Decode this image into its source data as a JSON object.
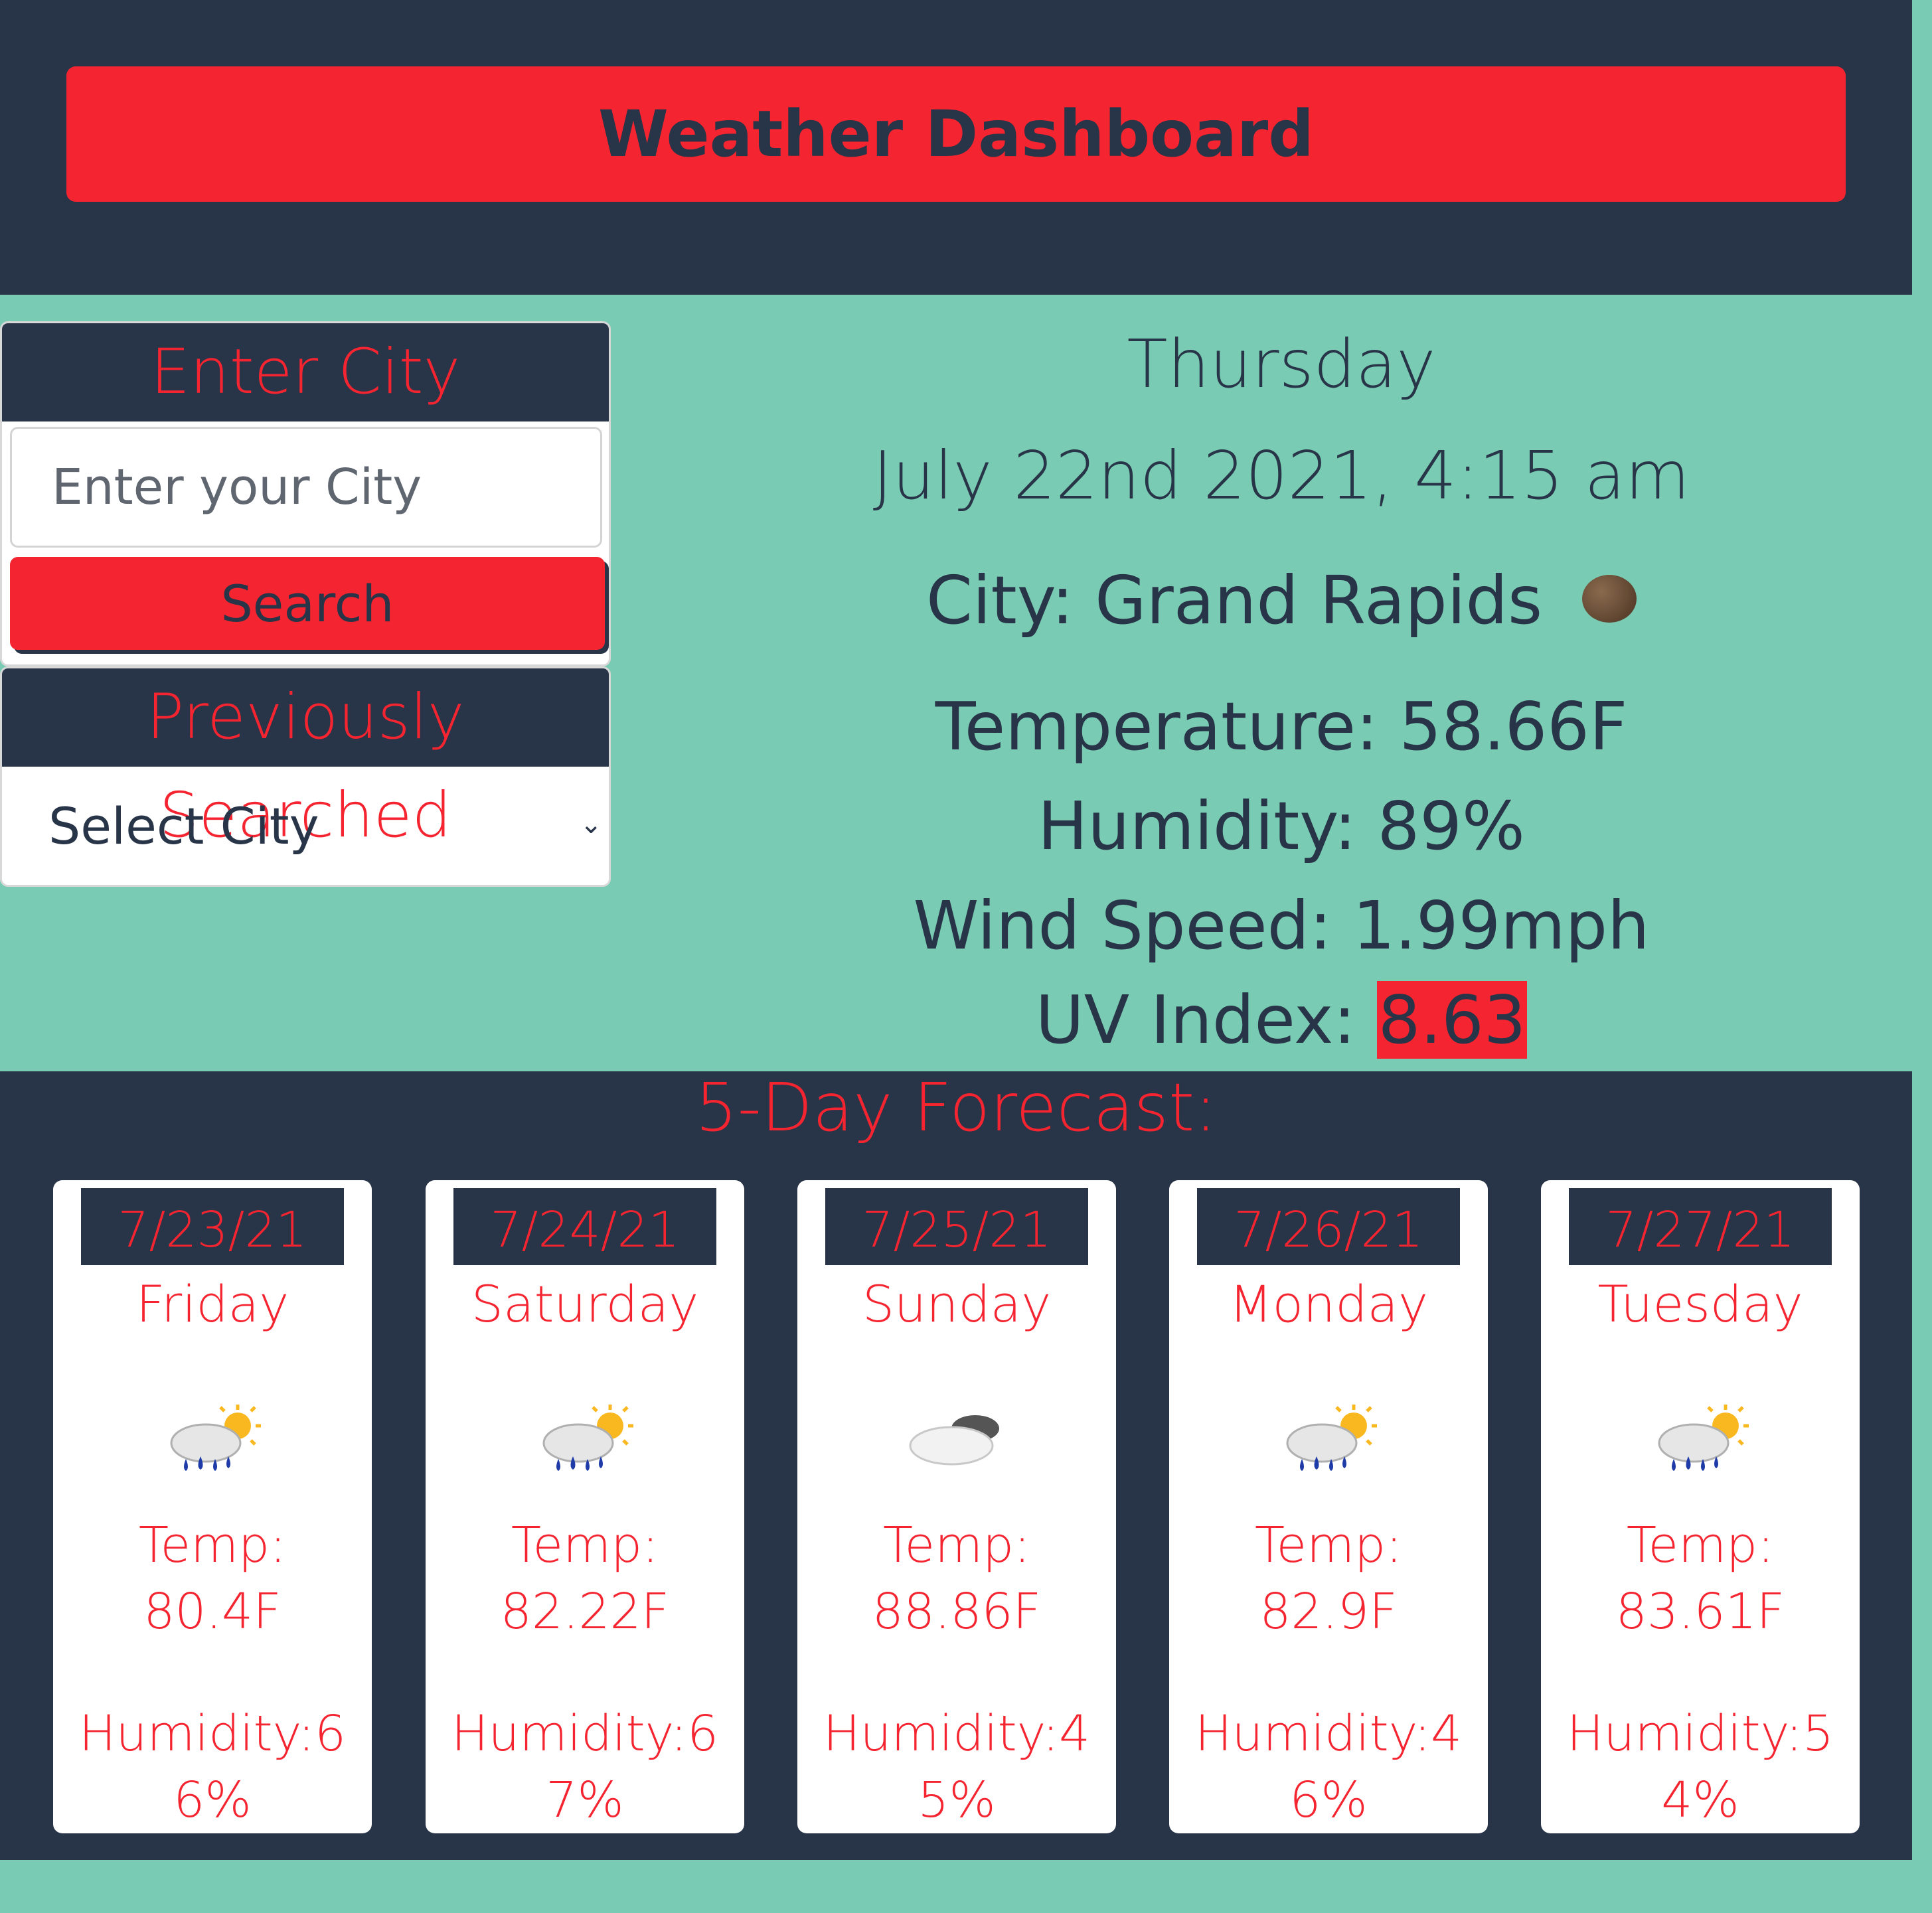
{
  "header": {
    "title": "Weather Dashboard"
  },
  "search_panel": {
    "heading": "Enter City",
    "input_placeholder": "Enter your City",
    "search_label": "Search"
  },
  "history_panel": {
    "heading": "Previously Searched",
    "select_value": "Select City"
  },
  "current": {
    "day": "Thursday",
    "datetime": "July 22nd 2021, 4:15 am",
    "city": "City: Grand Rapids",
    "weather_icon": "moon-icon",
    "temperature": "Temperature: 58.66F",
    "humidity": "Humidity: 89%",
    "wind": "Wind Speed: 1.99mph",
    "uv_label": "UV Index: ",
    "uv_value": "8.63"
  },
  "forecast": {
    "title": "5-Day Forecast:",
    "days": [
      {
        "date": "7/23/21",
        "day": "Friday",
        "icon": "rain-sun-icon",
        "temp_label": "Temp:",
        "temp": "80.4F",
        "humidity": "Humidity:66%"
      },
      {
        "date": "7/24/21",
        "day": "Saturday",
        "icon": "rain-sun-icon",
        "temp_label": "Temp:",
        "temp": "82.22F",
        "humidity": "Humidity:67%"
      },
      {
        "date": "7/25/21",
        "day": "Sunday",
        "icon": "cloud-icon",
        "temp_label": "Temp:",
        "temp": "88.86F",
        "humidity": "Humidity:45%"
      },
      {
        "date": "7/26/21",
        "day": "Monday",
        "icon": "rain-sun-icon",
        "temp_label": "Temp:",
        "temp": "82.9F",
        "humidity": "Humidity:46%"
      },
      {
        "date": "7/27/21",
        "day": "Tuesday",
        "icon": "rain-sun-icon",
        "temp_label": "Temp:",
        "temp": "83.61F",
        "humidity": "Humidity:54%"
      }
    ]
  },
  "colors": {
    "background": "#79cbb3",
    "navy": "#283447",
    "accent_red": "#f42530"
  }
}
